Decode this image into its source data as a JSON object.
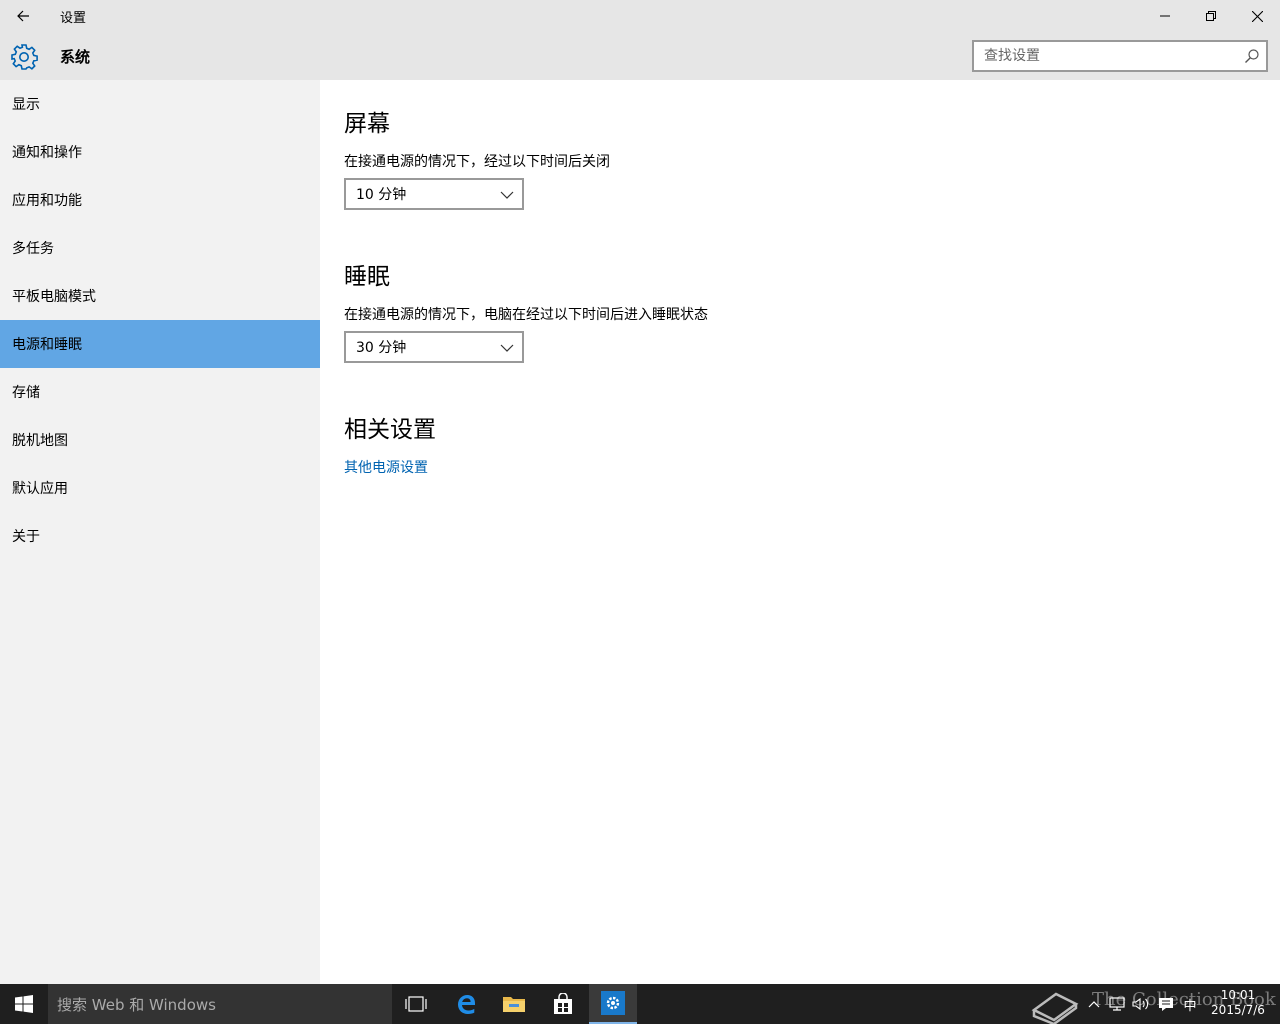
{
  "window": {
    "title": "设置",
    "controls": {
      "minimize": "minimize-icon",
      "maximize": "restore-icon",
      "close": "close-icon"
    }
  },
  "header": {
    "title": "系统",
    "icon": "gear-icon",
    "search": {
      "placeholder": "查找设置",
      "value": ""
    }
  },
  "sidebar": {
    "items": [
      {
        "label": "显示"
      },
      {
        "label": "通知和操作"
      },
      {
        "label": "应用和功能"
      },
      {
        "label": "多任务"
      },
      {
        "label": "平板电脑模式"
      },
      {
        "label": "电源和睡眠",
        "selected": true
      },
      {
        "label": "存储"
      },
      {
        "label": "脱机地图"
      },
      {
        "label": "默认应用"
      },
      {
        "label": "关于"
      }
    ],
    "selected_color": "#61a6e4"
  },
  "main": {
    "screen": {
      "title": "屏幕",
      "desc": "在接通电源的情况下，经过以下时间后关闭",
      "value": "10 分钟"
    },
    "sleep": {
      "title": "睡眠",
      "desc": "在接通电源的情况下，电脑在经过以下时间后进入睡眠状态",
      "value": "30 分钟"
    },
    "related": {
      "title": "相关设置",
      "link": "其他电源设置"
    },
    "link_color": "#0063b1"
  },
  "taskbar": {
    "search_placeholder": "搜索 Web 和 Windows",
    "icons": [
      "task-view-icon",
      "edge-icon",
      "file-explorer-icon",
      "store-icon",
      "settings-icon"
    ],
    "tray": {
      "ime": "中",
      "time": "10:01",
      "date": "2015/7/6"
    },
    "watermark": "The Collection Book"
  }
}
